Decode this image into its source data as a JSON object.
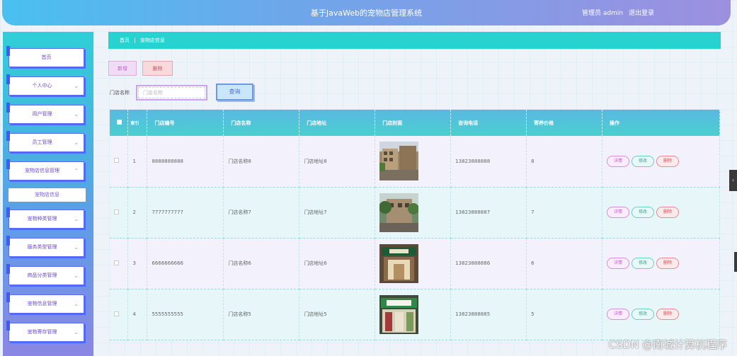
{
  "header": {
    "title": "基于JavaWeb的宠物店管理系统",
    "user": "管理员 admin",
    "logout": "退出登录"
  },
  "sidebar": {
    "items": [
      {
        "label": "首页",
        "chevron": false
      },
      {
        "label": "个人中心",
        "chevron": true
      },
      {
        "label": "用户管理",
        "chevron": true
      },
      {
        "label": "员工管理",
        "chevron": true
      },
      {
        "label": "宠物店信息管理",
        "chevron": true,
        "expanded": true
      },
      {
        "label": "宠物种类管理",
        "chevron": true
      },
      {
        "label": "服务类型管理",
        "chevron": true
      },
      {
        "label": "商品分类管理",
        "chevron": true
      },
      {
        "label": "宠物信息管理",
        "chevron": true
      },
      {
        "label": "宠物寄存管理",
        "chevron": true
      }
    ],
    "submenu": "宠物店信息"
  },
  "breadcrumb": {
    "home": "首页",
    "sep": "|",
    "current": "宠物店信息"
  },
  "toolbar": {
    "add": "新增",
    "delete": "删除"
  },
  "search": {
    "label": "门店名称",
    "placeholder": "门店名称",
    "button": "查询"
  },
  "table": {
    "columns": [
      "索引",
      "门店编号",
      "门店名称",
      "门店地址",
      "门店封面",
      "咨询电话",
      "寄养价格",
      "操作"
    ],
    "rows": [
      {
        "index": "1",
        "code": "8888888888",
        "name": "门店名称8",
        "address": "门店地址8",
        "phone": "13823888888",
        "price": "8"
      },
      {
        "index": "2",
        "code": "7777777777",
        "name": "门店名称7",
        "address": "门店地址7",
        "phone": "13823888887",
        "price": "7"
      },
      {
        "index": "3",
        "code": "6666666666",
        "name": "门店名称6",
        "address": "门店地址6",
        "phone": "13823888886",
        "price": "6"
      },
      {
        "index": "4",
        "code": "5555555555",
        "name": "门店名称5",
        "address": "门店地址5",
        "phone": "13823888885",
        "price": "5"
      }
    ],
    "actions": {
      "detail": "详情",
      "edit": "修改",
      "delete": "删除"
    }
  },
  "watermark": "CSDN @南城计算机程序"
}
